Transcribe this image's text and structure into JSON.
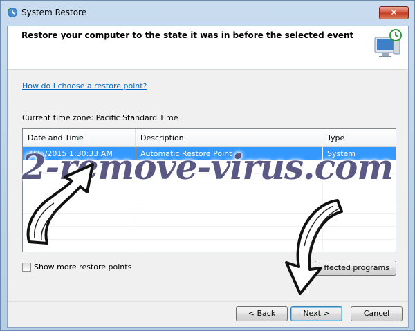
{
  "window": {
    "title": "System Restore",
    "close_label": "✕"
  },
  "header": {
    "title": "Restore your computer to the state it was in before the selected event"
  },
  "body": {
    "help_link": "How do I choose a restore point?",
    "timezone": "Current time zone: Pacific Standard Time",
    "table": {
      "columns": [
        "Date and Time",
        "Description",
        "Type"
      ],
      "rows": [
        [
          "3/25/2015 1:30:33 AM",
          "Automatic Restore Point",
          "System"
        ]
      ]
    },
    "show_more_label": "Show more restore points",
    "show_more_checked": false,
    "scan_button": "ffected programs"
  },
  "footer": {
    "back": "< Back",
    "next": "Next >",
    "cancel": "Cancel"
  },
  "watermark": "2-remove-virus.com",
  "colors": {
    "selection": "#3399ff",
    "link": "#0066cc",
    "close": "#c23a20"
  }
}
